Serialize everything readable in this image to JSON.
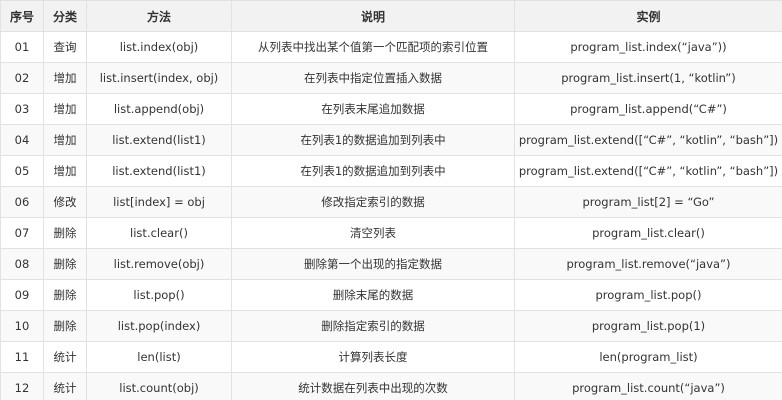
{
  "table": {
    "headers": [
      "序号",
      "分类",
      "方法",
      "说明",
      "实例"
    ],
    "rows": [
      {
        "no": "01",
        "category": "查询",
        "method": "list.index(obj)",
        "description": "从列表中找出某个值第一个匹配项的索引位置",
        "example": "program_list.index(“java”))"
      },
      {
        "no": "02",
        "category": "增加",
        "method": "list.insert(index, obj)",
        "description": "在列表中指定位置插入数据",
        "example": "program_list.insert(1, “kotlin”)"
      },
      {
        "no": "03",
        "category": "增加",
        "method": "list.append(obj)",
        "description": "在列表末尾追加数据",
        "example": "program_list.append(“C#”)"
      },
      {
        "no": "04",
        "category": "增加",
        "method": "list.extend(list1)",
        "description": "在列表1的数据追加到列表中",
        "example": "program_list.extend([“C#”, “kotlin”, “bash”])"
      },
      {
        "no": "05",
        "category": "增加",
        "method": "list.extend(list1)",
        "description": "在列表1的数据追加到列表中",
        "example": "program_list.extend([“C#”, “kotlin”, “bash”])"
      },
      {
        "no": "06",
        "category": "修改",
        "method": "list[index] = obj",
        "description": "修改指定索引的数据",
        "example": "program_list[2] = “Go”"
      },
      {
        "no": "07",
        "category": "删除",
        "method": "list.clear()",
        "description": "清空列表",
        "example": "program_list.clear()"
      },
      {
        "no": "08",
        "category": "删除",
        "method": "list.remove(obj)",
        "description": "删除第一个出现的指定数据",
        "example": "program_list.remove(“java”)"
      },
      {
        "no": "09",
        "category": "删除",
        "method": "list.pop()",
        "description": "删除末尾的数据",
        "example": "program_list.pop()"
      },
      {
        "no": "10",
        "category": "删除",
        "method": "list.pop(index)",
        "description": "删除指定索引的数据",
        "example": "program_list.pop(1)"
      },
      {
        "no": "11",
        "category": "统计",
        "method": "len(list)",
        "description": "计算列表长度",
        "example": "len(program_list)"
      },
      {
        "no": "12",
        "category": "统计",
        "method": "list.count(obj)",
        "description": "统计数据在列表中出现的次数",
        "example": "program_list.count(“java”)"
      }
    ]
  }
}
